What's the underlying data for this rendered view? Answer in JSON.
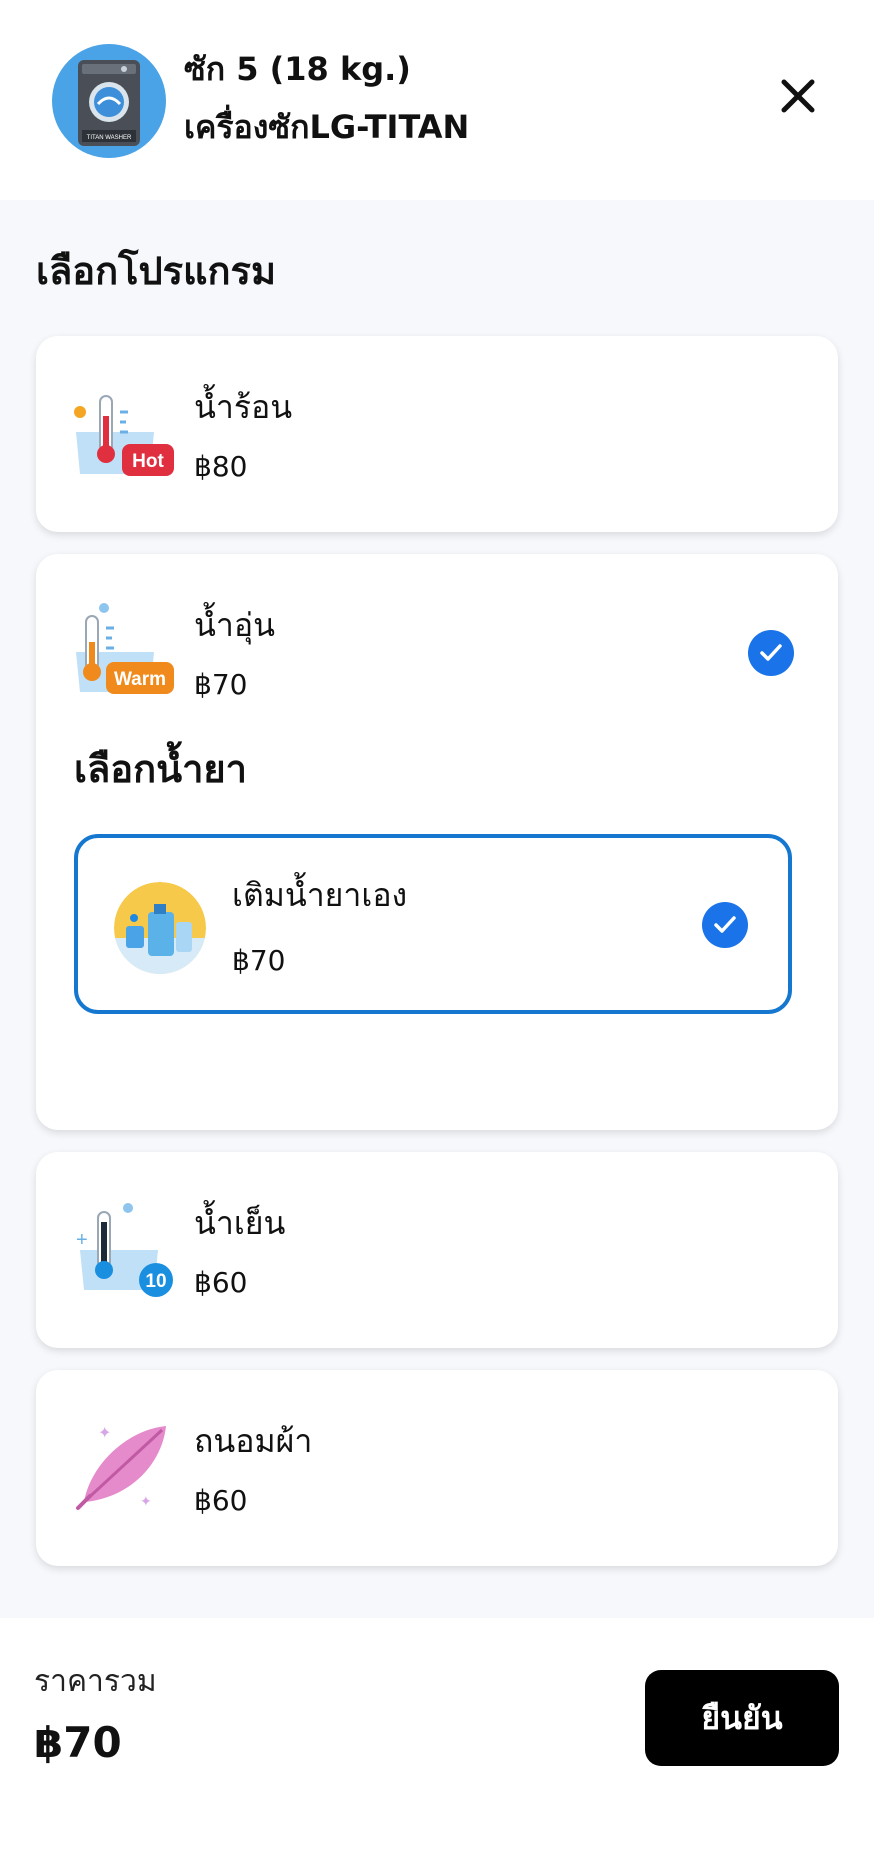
{
  "header": {
    "machine_line1": "ซัก 5  (18 kg.)",
    "machine_line2": "เครื่องซักLG-TITAN",
    "avatar_text": "TITAN WASHER"
  },
  "section_title": "เลือกโปรแกรม",
  "programs": [
    {
      "name": "น้ำร้อน",
      "price": "฿80",
      "badge": "Hot",
      "selected": false
    },
    {
      "name": "น้ำอุ่น",
      "price": "฿70",
      "badge": "Warm",
      "selected": true
    },
    {
      "name": "น้ำเย็น",
      "price": "฿60",
      "badge": "10",
      "selected": false
    },
    {
      "name": "ถนอมผ้า",
      "price": "฿60",
      "selected": false
    }
  ],
  "detergent": {
    "title": "เลือกน้ำยา",
    "option": {
      "name": "เติมน้ำยาเอง",
      "price": "฿70",
      "selected": true
    }
  },
  "footer": {
    "total_label": "ราคารวม",
    "total_value": "฿70",
    "confirm_label": "ยืนยัน"
  },
  "colors": {
    "accent": "#1a73e8",
    "selected_border": "#1677d0",
    "hot_badge": "#e0303f",
    "warm_badge": "#f08a1c",
    "cold_badge": "#1a8fe0",
    "background": "#f6f8fc"
  },
  "icons": {
    "close": "close-icon",
    "check": "check-icon",
    "hot": "hot-water-icon",
    "warm": "warm-water-icon",
    "cold": "cold-water-icon",
    "softener": "feather-icon",
    "detergent": "detergent-icon",
    "machine": "washing-machine-icon"
  }
}
